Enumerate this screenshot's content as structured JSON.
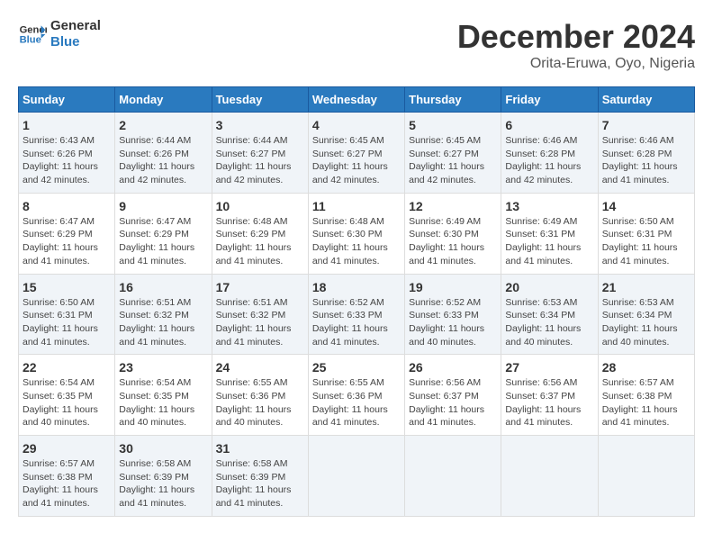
{
  "logo": {
    "line1": "General",
    "line2": "Blue"
  },
  "title": "December 2024",
  "location": "Orita-Eruwa, Oyo, Nigeria",
  "days_of_week": [
    "Sunday",
    "Monday",
    "Tuesday",
    "Wednesday",
    "Thursday",
    "Friday",
    "Saturday"
  ],
  "weeks": [
    [
      {
        "day": 1,
        "info": "Sunrise: 6:43 AM\nSunset: 6:26 PM\nDaylight: 11 hours\nand 42 minutes."
      },
      {
        "day": 2,
        "info": "Sunrise: 6:44 AM\nSunset: 6:26 PM\nDaylight: 11 hours\nand 42 minutes."
      },
      {
        "day": 3,
        "info": "Sunrise: 6:44 AM\nSunset: 6:27 PM\nDaylight: 11 hours\nand 42 minutes."
      },
      {
        "day": 4,
        "info": "Sunrise: 6:45 AM\nSunset: 6:27 PM\nDaylight: 11 hours\nand 42 minutes."
      },
      {
        "day": 5,
        "info": "Sunrise: 6:45 AM\nSunset: 6:27 PM\nDaylight: 11 hours\nand 42 minutes."
      },
      {
        "day": 6,
        "info": "Sunrise: 6:46 AM\nSunset: 6:28 PM\nDaylight: 11 hours\nand 42 minutes."
      },
      {
        "day": 7,
        "info": "Sunrise: 6:46 AM\nSunset: 6:28 PM\nDaylight: 11 hours\nand 41 minutes."
      }
    ],
    [
      {
        "day": 8,
        "info": "Sunrise: 6:47 AM\nSunset: 6:29 PM\nDaylight: 11 hours\nand 41 minutes."
      },
      {
        "day": 9,
        "info": "Sunrise: 6:47 AM\nSunset: 6:29 PM\nDaylight: 11 hours\nand 41 minutes."
      },
      {
        "day": 10,
        "info": "Sunrise: 6:48 AM\nSunset: 6:29 PM\nDaylight: 11 hours\nand 41 minutes."
      },
      {
        "day": 11,
        "info": "Sunrise: 6:48 AM\nSunset: 6:30 PM\nDaylight: 11 hours\nand 41 minutes."
      },
      {
        "day": 12,
        "info": "Sunrise: 6:49 AM\nSunset: 6:30 PM\nDaylight: 11 hours\nand 41 minutes."
      },
      {
        "day": 13,
        "info": "Sunrise: 6:49 AM\nSunset: 6:31 PM\nDaylight: 11 hours\nand 41 minutes."
      },
      {
        "day": 14,
        "info": "Sunrise: 6:50 AM\nSunset: 6:31 PM\nDaylight: 11 hours\nand 41 minutes."
      }
    ],
    [
      {
        "day": 15,
        "info": "Sunrise: 6:50 AM\nSunset: 6:31 PM\nDaylight: 11 hours\nand 41 minutes."
      },
      {
        "day": 16,
        "info": "Sunrise: 6:51 AM\nSunset: 6:32 PM\nDaylight: 11 hours\nand 41 minutes."
      },
      {
        "day": 17,
        "info": "Sunrise: 6:51 AM\nSunset: 6:32 PM\nDaylight: 11 hours\nand 41 minutes."
      },
      {
        "day": 18,
        "info": "Sunrise: 6:52 AM\nSunset: 6:33 PM\nDaylight: 11 hours\nand 41 minutes."
      },
      {
        "day": 19,
        "info": "Sunrise: 6:52 AM\nSunset: 6:33 PM\nDaylight: 11 hours\nand 40 minutes."
      },
      {
        "day": 20,
        "info": "Sunrise: 6:53 AM\nSunset: 6:34 PM\nDaylight: 11 hours\nand 40 minutes."
      },
      {
        "day": 21,
        "info": "Sunrise: 6:53 AM\nSunset: 6:34 PM\nDaylight: 11 hours\nand 40 minutes."
      }
    ],
    [
      {
        "day": 22,
        "info": "Sunrise: 6:54 AM\nSunset: 6:35 PM\nDaylight: 11 hours\nand 40 minutes."
      },
      {
        "day": 23,
        "info": "Sunrise: 6:54 AM\nSunset: 6:35 PM\nDaylight: 11 hours\nand 40 minutes."
      },
      {
        "day": 24,
        "info": "Sunrise: 6:55 AM\nSunset: 6:36 PM\nDaylight: 11 hours\nand 40 minutes."
      },
      {
        "day": 25,
        "info": "Sunrise: 6:55 AM\nSunset: 6:36 PM\nDaylight: 11 hours\nand 41 minutes."
      },
      {
        "day": 26,
        "info": "Sunrise: 6:56 AM\nSunset: 6:37 PM\nDaylight: 11 hours\nand 41 minutes."
      },
      {
        "day": 27,
        "info": "Sunrise: 6:56 AM\nSunset: 6:37 PM\nDaylight: 11 hours\nand 41 minutes."
      },
      {
        "day": 28,
        "info": "Sunrise: 6:57 AM\nSunset: 6:38 PM\nDaylight: 11 hours\nand 41 minutes."
      }
    ],
    [
      {
        "day": 29,
        "info": "Sunrise: 6:57 AM\nSunset: 6:38 PM\nDaylight: 11 hours\nand 41 minutes."
      },
      {
        "day": 30,
        "info": "Sunrise: 6:58 AM\nSunset: 6:39 PM\nDaylight: 11 hours\nand 41 minutes."
      },
      {
        "day": 31,
        "info": "Sunrise: 6:58 AM\nSunset: 6:39 PM\nDaylight: 11 hours\nand 41 minutes."
      },
      null,
      null,
      null,
      null
    ]
  ]
}
